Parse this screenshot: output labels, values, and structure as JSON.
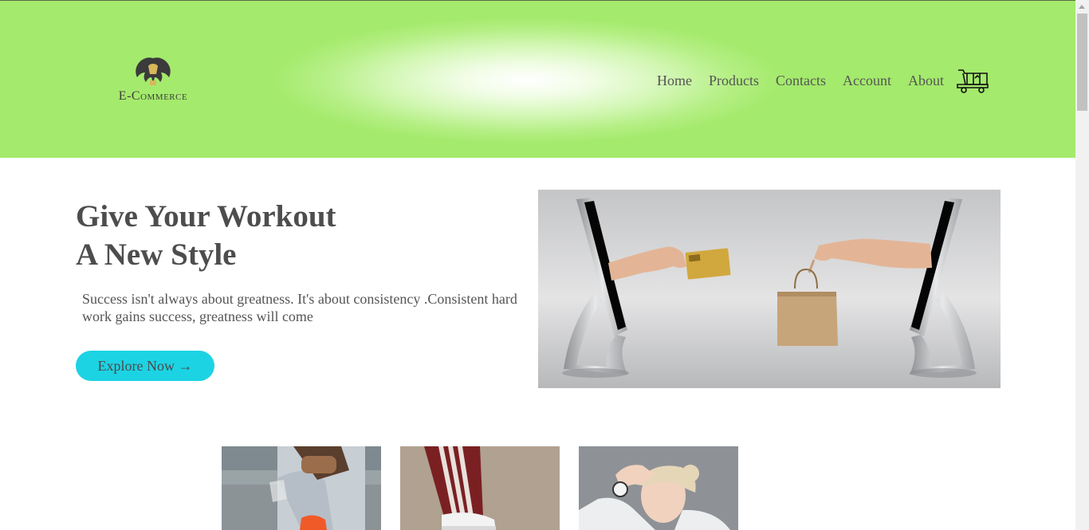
{
  "header": {
    "logo_text": "E-Commerce",
    "nav": [
      {
        "label": "Home"
      },
      {
        "label": "Products"
      },
      {
        "label": "Contacts"
      },
      {
        "label": "Account"
      },
      {
        "label": "About"
      }
    ],
    "cart_icon": "shopping-cart-icon"
  },
  "hero": {
    "title": "Give Your Workout\nA New Style",
    "text": "Success isn't always about greatness. It's about consistency .Consistent hard work gains success, greatness will come",
    "button_label": "Explore Now →",
    "accent_color": "#1cd3e4"
  },
  "colors": {
    "header_green": "#a4ea6c",
    "text": "#555555"
  }
}
